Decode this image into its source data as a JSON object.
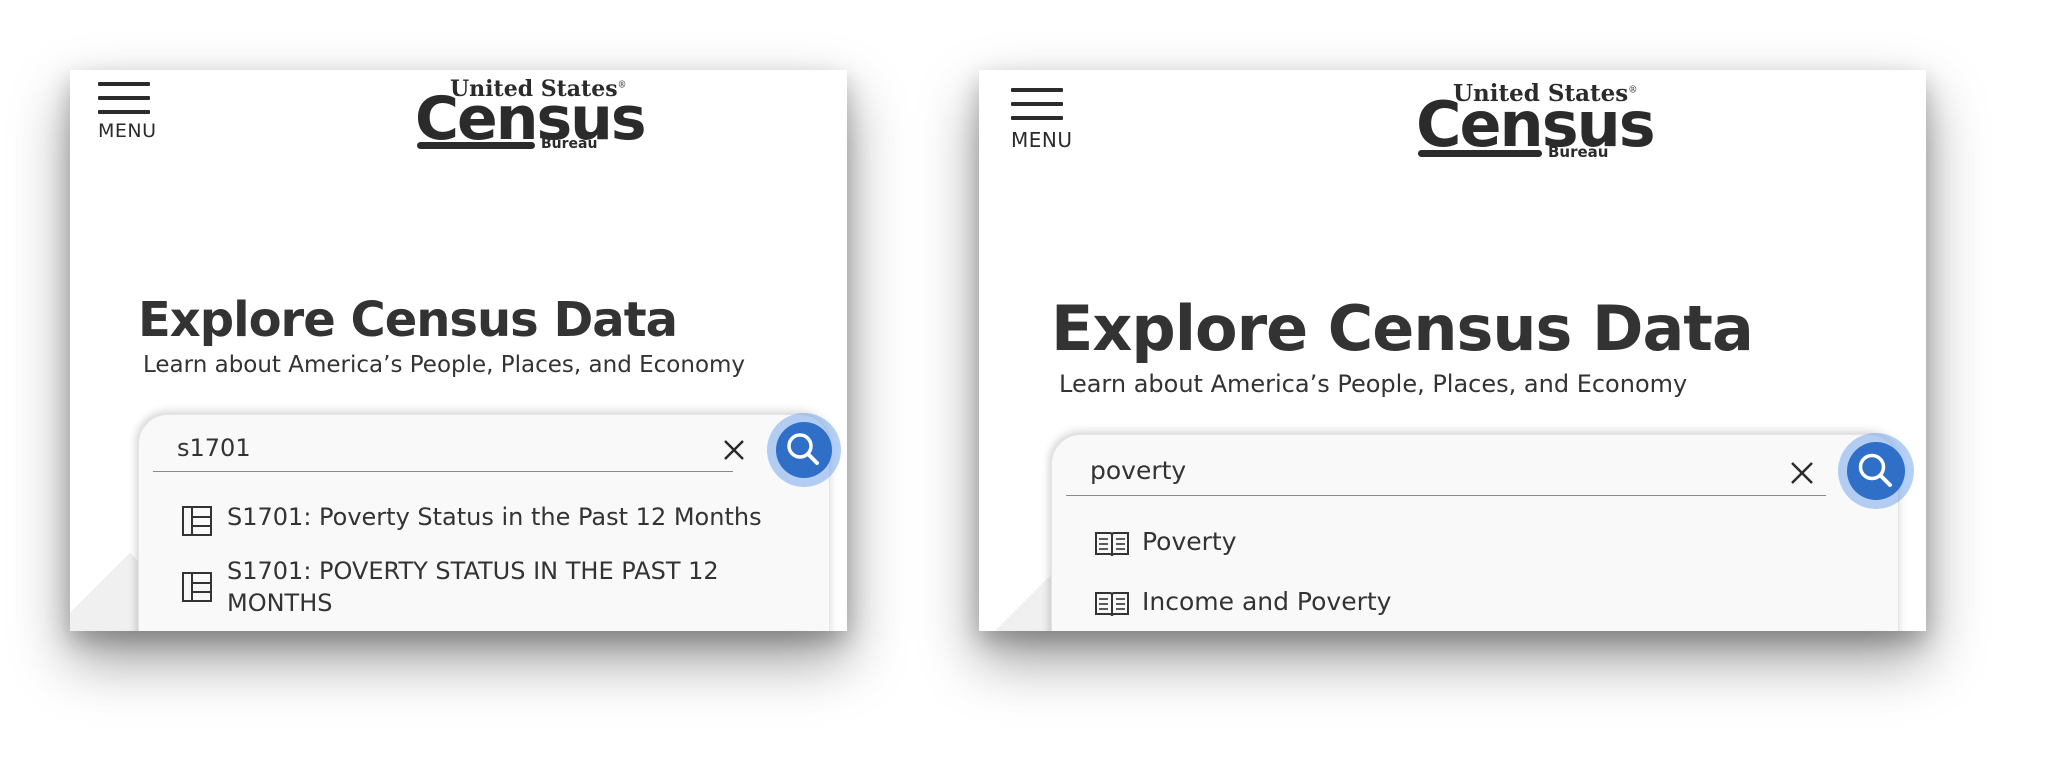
{
  "menu_label": "MENU",
  "logo": {
    "line1": "United States",
    "registered": "®",
    "line2": "Census",
    "line3": "Bureau"
  },
  "hero": {
    "title": "Explore Census Data",
    "subtitle": "Learn about America’s People, Places, and Economy"
  },
  "left_panel": {
    "search_value": "s1701",
    "suggestions": [
      {
        "icon": "table-icon",
        "lines": [
          "S1701: Poverty Status in the Past 12 Months"
        ]
      },
      {
        "icon": "table-icon",
        "lines": [
          "S1701: POVERTY STATUS IN THE PAST 12",
          "MONTHS"
        ]
      }
    ]
  },
  "right_panel": {
    "search_value": "poverty",
    "suggestions": [
      {
        "icon": "book-icon",
        "label": "Poverty"
      },
      {
        "icon": "book-icon",
        "label": "Income and Poverty"
      }
    ]
  },
  "colors": {
    "accent": "#2f6fc7",
    "text": "#333333",
    "logo": "#2b2b2b"
  }
}
